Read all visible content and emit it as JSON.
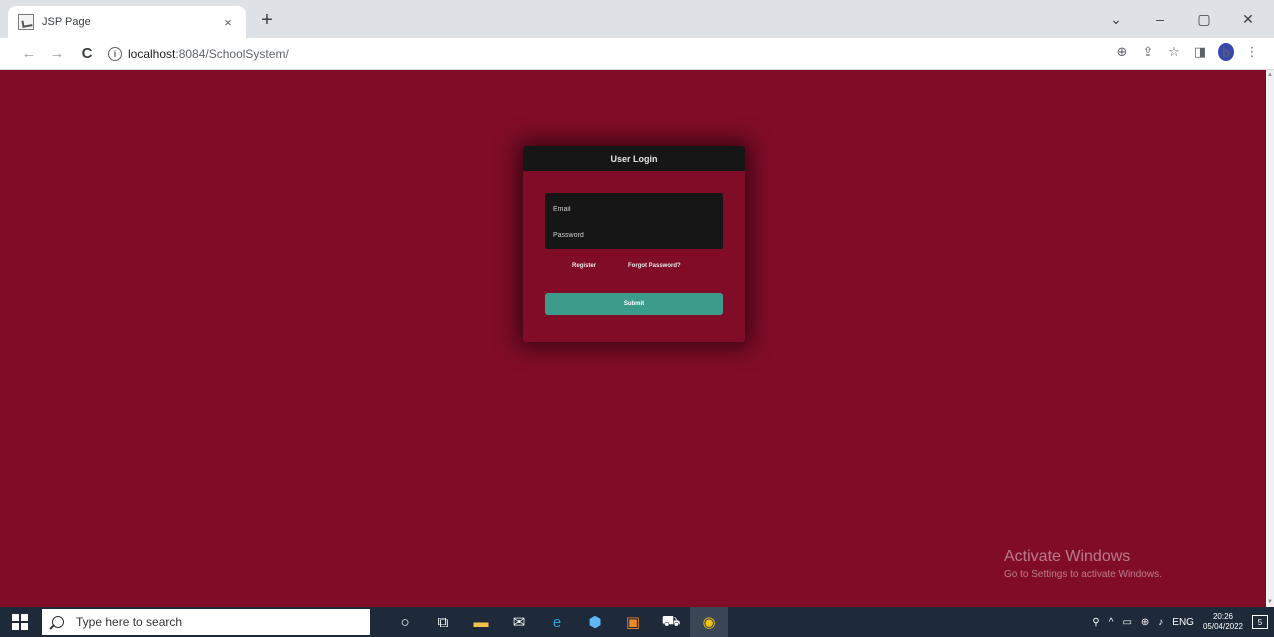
{
  "browser": {
    "tab_title": "JSP Page",
    "tab_close": "×",
    "new_tab": "+",
    "window_controls": [
      "⌄",
      "–",
      "▢",
      "✕"
    ],
    "back": "←",
    "forward": "→",
    "reload": "C",
    "info": "i",
    "url_host": "localhost",
    "url_path": ":8084/SchoolSystem/",
    "toolbar_icons": [
      "⊕",
      "⇪",
      "☆",
      "◨"
    ],
    "profile_initial": "b"
  },
  "login": {
    "header": "User Login",
    "email_placeholder": "Email",
    "password_placeholder": "Password",
    "register_link": "Register",
    "forgot_link": "Forgot Password?",
    "submit_label": "Submit"
  },
  "watermark": {
    "title": "Activate Windows",
    "subtitle": "Go to Settings to activate Windows."
  },
  "taskbar": {
    "search_placeholder": "Type here to search",
    "apps": [
      {
        "name": "cortana-icon",
        "glyph": "○",
        "color": "#ffffff"
      },
      {
        "name": "task-view-icon",
        "glyph": "⧉",
        "color": "#ffffff"
      },
      {
        "name": "file-explorer-icon",
        "glyph": "▬",
        "color": "#f2c14e"
      },
      {
        "name": "mail-icon",
        "glyph": "✉",
        "color": "#ffffff"
      },
      {
        "name": "edge-icon",
        "glyph": "e",
        "color": "#2d9fd9"
      },
      {
        "name": "app-icon",
        "glyph": "⬢",
        "color": "#5fb8f5"
      },
      {
        "name": "xampp-icon",
        "glyph": "▣",
        "color": "#f08a24"
      },
      {
        "name": "store-icon",
        "glyph": "⛟",
        "color": "#ffffff"
      },
      {
        "name": "chrome-icon",
        "glyph": "◉",
        "color": "#f4c20d"
      }
    ],
    "tray_icons": [
      "⚲",
      "^",
      "▭",
      "⊕",
      "♪"
    ],
    "language": "ENG",
    "time": "20:26",
    "date": "05/04/2022",
    "notification": "5"
  },
  "colors": {
    "page_background": "#800c28",
    "card_header": "#161616",
    "submit_button": "#3d9b8c"
  }
}
